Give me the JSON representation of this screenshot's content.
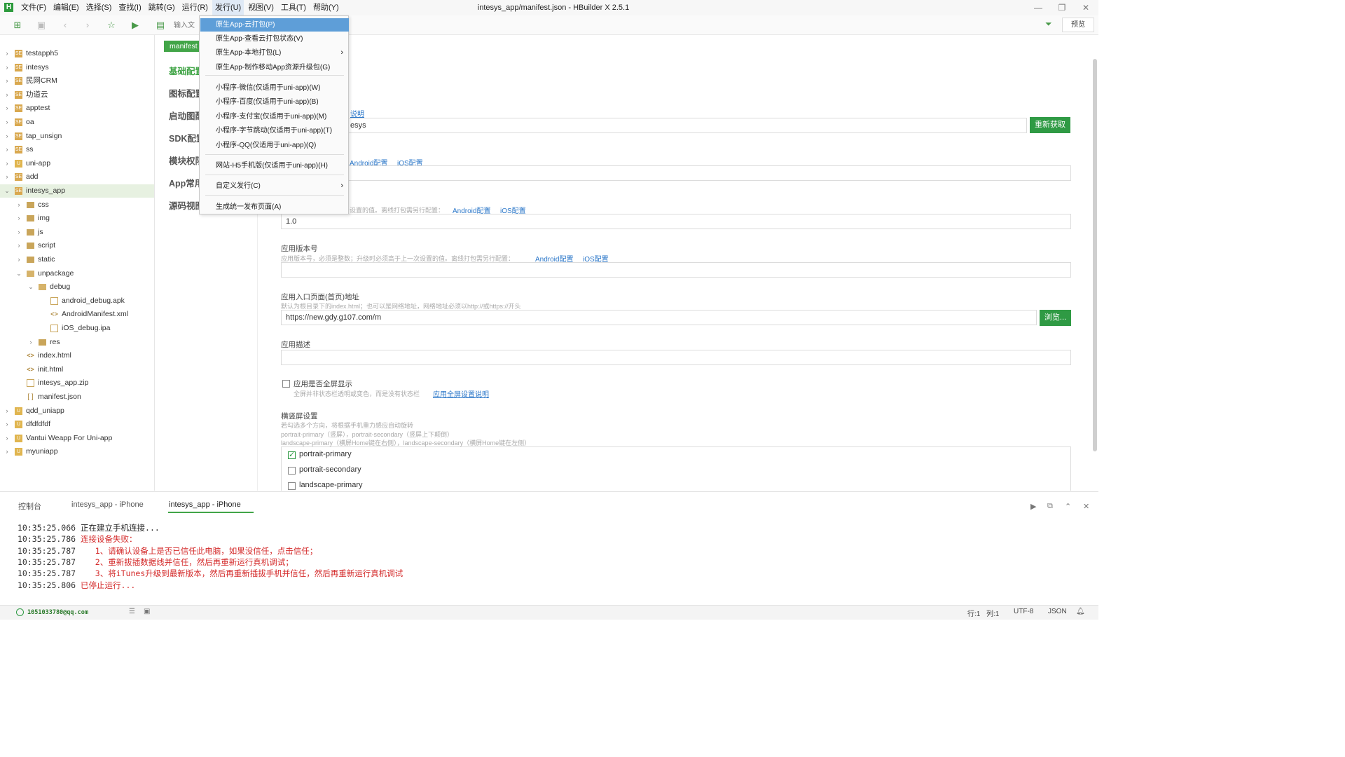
{
  "window": {
    "title": "intesys_app/manifest.json - HBuilder X 2.5.1"
  },
  "menubar": {
    "items": [
      "文件(F)",
      "编辑(E)",
      "选择(S)",
      "查找(I)",
      "跳转(G)",
      "运行(R)",
      "发行(U)",
      "视图(V)",
      "工具(T)",
      "帮助(Y)"
    ],
    "active_index": 6
  },
  "toolbar": {
    "search_placeholder": "输入文",
    "preview_label": "预览"
  },
  "sidebar": {
    "items": [
      {
        "label": "testapph5",
        "level": 0,
        "icon": "project-icon",
        "chevron": "›"
      },
      {
        "label": "intesys",
        "level": 0,
        "icon": "project-icon",
        "chevron": "›"
      },
      {
        "label": "民网CRM",
        "level": 0,
        "icon": "project-icon",
        "chevron": "›"
      },
      {
        "label": "功道云",
        "level": 0,
        "icon": "project-icon",
        "chevron": "›"
      },
      {
        "label": "apptest",
        "level": 0,
        "icon": "project-icon",
        "chevron": "›"
      },
      {
        "label": "oa",
        "level": 0,
        "icon": "project-icon",
        "chevron": "›"
      },
      {
        "label": "tap_unsign",
        "level": 0,
        "icon": "project-icon",
        "chevron": "›"
      },
      {
        "label": "ss",
        "level": 0,
        "icon": "project-icon",
        "chevron": "›"
      },
      {
        "label": "uni-app",
        "level": 0,
        "icon": "uniapp-icon",
        "chevron": "›"
      },
      {
        "label": "add",
        "level": 0,
        "icon": "project-icon",
        "chevron": "›"
      },
      {
        "label": "intesys_app",
        "level": 0,
        "icon": "project-icon",
        "chevron": "⌄",
        "selected": true
      },
      {
        "label": "css",
        "level": 1,
        "icon": "folder-icon",
        "chevron": "›"
      },
      {
        "label": "img",
        "level": 1,
        "icon": "folder-icon",
        "chevron": "›"
      },
      {
        "label": "js",
        "level": 1,
        "icon": "folder-icon",
        "chevron": "›"
      },
      {
        "label": "script",
        "level": 1,
        "icon": "folder-icon",
        "chevron": "›"
      },
      {
        "label": "static",
        "level": 1,
        "icon": "folder-icon",
        "chevron": "›"
      },
      {
        "label": "unpackage",
        "level": 1,
        "icon": "folder-open-icon",
        "chevron": "⌄"
      },
      {
        "label": "debug",
        "level": 2,
        "icon": "folder-open-icon",
        "chevron": "⌄"
      },
      {
        "label": "android_debug.apk",
        "level": 3,
        "icon": "file-icon",
        "chevron": ""
      },
      {
        "label": "AndroidManifest.xml",
        "level": 3,
        "icon": "code-file-icon",
        "chevron": ""
      },
      {
        "label": "iOS_debug.ipa",
        "level": 3,
        "icon": "file-icon",
        "chevron": ""
      },
      {
        "label": "res",
        "level": 2,
        "icon": "folder-icon",
        "chevron": "›"
      },
      {
        "label": "index.html",
        "level": 1,
        "icon": "code-file-icon",
        "chevron": ""
      },
      {
        "label": "init.html",
        "level": 1,
        "icon": "code-file-icon",
        "chevron": ""
      },
      {
        "label": "intesys_app.zip",
        "level": 1,
        "icon": "file-icon",
        "chevron": ""
      },
      {
        "label": "manifest.json",
        "level": 1,
        "icon": "json-file-icon",
        "chevron": ""
      },
      {
        "label": "qdd_uniapp",
        "level": 0,
        "icon": "uniapp-icon",
        "chevron": "›"
      },
      {
        "label": "dfdfdfdf",
        "level": 0,
        "icon": "uniapp-icon",
        "chevron": "›"
      },
      {
        "label": "Vantui Weapp For Uni-app",
        "level": 0,
        "icon": "uniapp-icon",
        "chevron": "›"
      },
      {
        "label": "myuniapp",
        "level": 0,
        "icon": "uniapp-icon",
        "chevron": "›"
      }
    ]
  },
  "editor": {
    "tab_label": "manifest",
    "nav": [
      "基础配置",
      "图标配置",
      "启动图配置",
      "SDK配置",
      "模块权限配置",
      "App常用其它设置",
      "源码视图"
    ],
    "nav_active_index": 0,
    "form": {
      "appid_link_fragment": "说明",
      "appid_value": "esys",
      "refresh_button": "重新获取",
      "desc_links": [
        "Android配置",
        "iOS配置"
      ],
      "version_name_hint": "设置的值。离线打包需另行配置：",
      "version_name_links": [
        "Android配置",
        "iOS配置"
      ],
      "version_name_value": "1.0",
      "version_code_label": "应用版本号",
      "version_code_hint": "应用版本号，必须是整数；升级时必须高于上一次设置的值。离线打包需另行配置：",
      "version_code_links": [
        "Android配置",
        "iOS配置"
      ],
      "version_code_value": "",
      "entry_label": "应用入口页面(首页)地址",
      "entry_hint": "默认为根目录下的index.html；也可以是网络地址，网络地址必须以http://或https://开头",
      "entry_value": "https://new.gdy.g107.com/m",
      "browse_button": "浏览...",
      "desc_label": "应用描述",
      "desc_value": "",
      "fullscreen_label": "应用是否全屏显示",
      "fullscreen_hint": "全屏并非状态栏透明或变色，而是没有状态栏",
      "fullscreen_link": "应用全屏设置说明",
      "orientation_label": "横竖屏设置",
      "orientation_hint1": "若勾选多个方向，将根据手机重力感应自动旋转",
      "orientation_hint2": "portrait-primary（竖屏），portrait-secondary（竖屏上下颠倒）",
      "orientation_hint3": "landscape-primary（横屏Home键在右侧），landscape-secondary（横屏Home键在左侧）",
      "orientations": [
        {
          "label": "portrait-primary",
          "checked": true
        },
        {
          "label": "portrait-secondary",
          "checked": false
        },
        {
          "label": "landscape-primary",
          "checked": false
        }
      ]
    }
  },
  "dropdown": {
    "items": [
      {
        "label": "原生App-云打包(P)",
        "highlighted": true
      },
      {
        "label": "原生App-查看云打包状态(V)"
      },
      {
        "label": "原生App-本地打包(L)",
        "submenu": true
      },
      {
        "label": "原生App-制作移动App资源升级包(G)"
      },
      {
        "label": "小程序-微信(仅适用于uni-app)(W)"
      },
      {
        "label": "小程序-百度(仅适用于uni-app)(B)"
      },
      {
        "label": "小程序-支付宝(仅适用于uni-app)(M)"
      },
      {
        "label": "小程序-字节跳动(仅适用于uni-app)(T)"
      },
      {
        "label": "小程序-QQ(仅适用于uni-app)(Q)"
      },
      {
        "label": "网站-H5手机版(仅适用于uni-app)(H)"
      },
      {
        "label": "自定义发行(C)",
        "submenu": true
      },
      {
        "label": "生成统一发布页面(A)"
      }
    ]
  },
  "console": {
    "tabs": [
      "控制台",
      "intesys_app - iPhone",
      "intesys_app - iPhone"
    ],
    "active_tab_index": 2,
    "lines": [
      {
        "time": "10:35:25.066",
        "text": " 正在建立手机连接...",
        "color": "black"
      },
      {
        "time": "10:35:25.786",
        "text": " 连接设备失败：",
        "color": "red"
      },
      {
        "time": "10:35:25.787",
        "text": "    1、请确认设备上是否已信任此电脑，如果没信任，点击信任；",
        "color": "red"
      },
      {
        "time": "10:35:25.787",
        "text": "    2、重新拔插数据线并信任，然后再重新运行真机调试；",
        "color": "red"
      },
      {
        "time": "10:35:25.787",
        "text": "    3、将iTunes升级到最新版本，然后再重新插拔手机并信任，然后再重新运行真机调试",
        "color": "red"
      },
      {
        "time": "10:35:25.806",
        "text": " 已停止运行...",
        "color": "red"
      }
    ]
  },
  "statusbar": {
    "user": "1051033780@qq.com",
    "line": "行:1",
    "col": "列:1",
    "encoding": "UTF-8",
    "language": "JSON"
  },
  "colors": {
    "accent": "#42a548",
    "menu_highlight": "#5e9ed8",
    "error_text": "#d42a2a"
  }
}
